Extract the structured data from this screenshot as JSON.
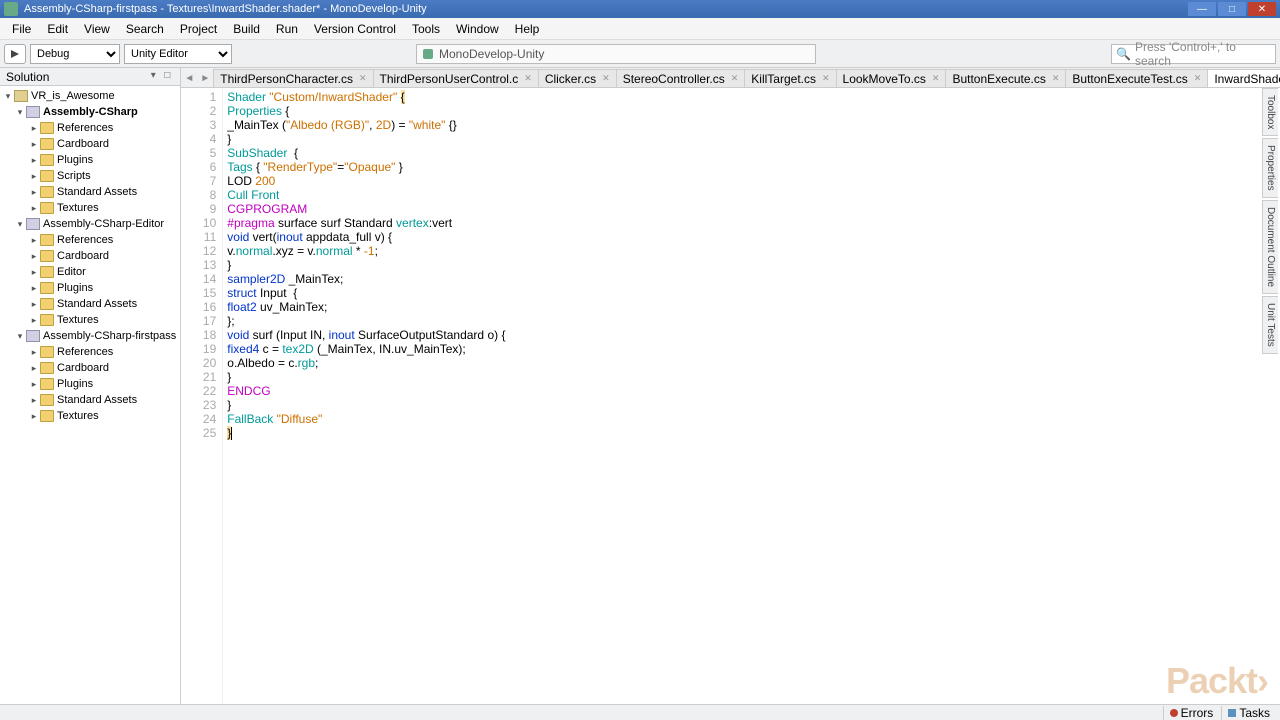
{
  "window": {
    "title": "Assembly-CSharp-firstpass - Textures\\InwardShader.shader* - MonoDevelop-Unity"
  },
  "menu": [
    "File",
    "Edit",
    "View",
    "Search",
    "Project",
    "Build",
    "Run",
    "Version Control",
    "Tools",
    "Window",
    "Help"
  ],
  "toolbar": {
    "config": "Debug",
    "target": "Unity Editor",
    "status": "MonoDevelop-Unity",
    "search_placeholder": "Press 'Control+,' to search"
  },
  "solution": {
    "title": "Solution",
    "root": "VR_is_Awesome",
    "projects": [
      {
        "name": "Assembly-CSharp",
        "bold": true,
        "children": [
          "References",
          "Cardboard",
          "Plugins",
          "Scripts",
          "Standard Assets",
          "Textures"
        ]
      },
      {
        "name": "Assembly-CSharp-Editor",
        "bold": false,
        "children": [
          "References",
          "Cardboard",
          "Editor",
          "Plugins",
          "Standard Assets",
          "Textures"
        ]
      },
      {
        "name": "Assembly-CSharp-firstpass",
        "bold": false,
        "children": [
          "References",
          "Cardboard",
          "Plugins",
          "Standard Assets",
          "Textures"
        ]
      }
    ]
  },
  "tabs": [
    {
      "label": "ThirdPersonCharacter.cs"
    },
    {
      "label": "ThirdPersonUserControl.c"
    },
    {
      "label": "Clicker.cs"
    },
    {
      "label": "StereoController.cs"
    },
    {
      "label": "KillTarget.cs"
    },
    {
      "label": "LookMoveTo.cs"
    },
    {
      "label": "ButtonExecute.cs"
    },
    {
      "label": "ButtonExecuteTest.cs"
    },
    {
      "label": "InwardShader.shader",
      "active": true,
      "dirty": true
    }
  ],
  "code": [
    {
      "n": 1,
      "tokens": [
        {
          "t": "Shader ",
          "c": "kw1"
        },
        {
          "t": "\"Custom/InwardShader\"",
          "c": "str"
        },
        {
          "t": " "
        },
        {
          "t": "{",
          "c": "brace-hl"
        }
      ]
    },
    {
      "n": 2,
      "tokens": [
        {
          "t": "Properties ",
          "c": "kw1"
        },
        {
          "t": "{"
        }
      ]
    },
    {
      "n": 3,
      "tokens": [
        {
          "t": "_MainTex ("
        },
        {
          "t": "\"Albedo (RGB)\"",
          "c": "str"
        },
        {
          "t": ", "
        },
        {
          "t": "2D",
          "c": "num"
        },
        {
          "t": ") = "
        },
        {
          "t": "\"white\"",
          "c": "str"
        },
        {
          "t": " {}"
        }
      ]
    },
    {
      "n": 4,
      "tokens": [
        {
          "t": "}"
        }
      ]
    },
    {
      "n": 5,
      "tokens": [
        {
          "t": "SubShader ",
          "c": "kw1"
        },
        {
          "t": " {"
        }
      ]
    },
    {
      "n": 6,
      "tokens": [
        {
          "t": "Tags ",
          "c": "kw1"
        },
        {
          "t": "{ "
        },
        {
          "t": "\"RenderType\"",
          "c": "str"
        },
        {
          "t": "="
        },
        {
          "t": "\"Opaque\"",
          "c": "str"
        },
        {
          "t": " }"
        }
      ]
    },
    {
      "n": 7,
      "tokens": [
        {
          "t": "LOD "
        },
        {
          "t": "200",
          "c": "num"
        }
      ]
    },
    {
      "n": 8,
      "tokens": [
        {
          "t": "Cull ",
          "c": "kw1"
        },
        {
          "t": "Front",
          "c": "kw1"
        }
      ]
    },
    {
      "n": 9,
      "tokens": [
        {
          "t": "CGPROGRAM",
          "c": "mag"
        }
      ]
    },
    {
      "n": 10,
      "tokens": [
        {
          "t": "#pragma",
          "c": "mag"
        },
        {
          "t": " surface surf Standard "
        },
        {
          "t": "vertex",
          "c": "kw1"
        },
        {
          "t": ":vert"
        }
      ]
    },
    {
      "n": 11,
      "tokens": [
        {
          "t": "void ",
          "c": "kw2"
        },
        {
          "t": "vert("
        },
        {
          "t": "inout",
          "c": "kw2"
        },
        {
          "t": " appdata_full v) {"
        }
      ]
    },
    {
      "n": 12,
      "tokens": [
        {
          "t": "v."
        },
        {
          "t": "normal",
          "c": "kw1"
        },
        {
          "t": ".xyz = v."
        },
        {
          "t": "normal",
          "c": "kw1"
        },
        {
          "t": " * "
        },
        {
          "t": "-1",
          "c": "num"
        },
        {
          "t": ";"
        }
      ]
    },
    {
      "n": 13,
      "tokens": [
        {
          "t": "}"
        }
      ]
    },
    {
      "n": 14,
      "tokens": [
        {
          "t": "sampler2D",
          "c": "kw2"
        },
        {
          "t": " _MainTex;"
        }
      ]
    },
    {
      "n": 15,
      "tokens": [
        {
          "t": "struct",
          "c": "kw2"
        },
        {
          "t": " Input  {"
        }
      ]
    },
    {
      "n": 16,
      "tokens": [
        {
          "t": "float2",
          "c": "kw2"
        },
        {
          "t": " uv_MainTex;"
        }
      ]
    },
    {
      "n": 17,
      "tokens": [
        {
          "t": "};"
        }
      ]
    },
    {
      "n": 18,
      "tokens": [
        {
          "t": "void ",
          "c": "kw2"
        },
        {
          "t": "surf (Input IN, "
        },
        {
          "t": "inout",
          "c": "kw2"
        },
        {
          "t": " SurfaceOutputStandard o) {"
        }
      ]
    },
    {
      "n": 19,
      "tokens": [
        {
          "t": "fixed4",
          "c": "kw2"
        },
        {
          "t": " c = "
        },
        {
          "t": "tex2D",
          "c": "kw1"
        },
        {
          "t": " (_MainTex, IN.uv_MainTex);"
        }
      ]
    },
    {
      "n": 20,
      "tokens": [
        {
          "t": "o.Albedo = c."
        },
        {
          "t": "rgb",
          "c": "kw1"
        },
        {
          "t": ";"
        }
      ]
    },
    {
      "n": 21,
      "tokens": [
        {
          "t": "}"
        }
      ]
    },
    {
      "n": 22,
      "tokens": [
        {
          "t": "ENDCG",
          "c": "mag"
        }
      ]
    },
    {
      "n": 23,
      "tokens": [
        {
          "t": "}"
        }
      ]
    },
    {
      "n": 24,
      "tokens": [
        {
          "t": "FallBack ",
          "c": "kw1"
        },
        {
          "t": "\"Diffuse\"",
          "c": "str"
        }
      ]
    },
    {
      "n": 25,
      "tokens": [
        {
          "t": "}",
          "c": "brace-hl"
        }
      ],
      "caret": true
    }
  ],
  "rtabs": [
    "Toolbox",
    "Properties",
    "Document Outline",
    "Unit Tests"
  ],
  "statusbar": {
    "errors": "Errors",
    "tasks": "Tasks"
  },
  "watermark": "Packt›"
}
